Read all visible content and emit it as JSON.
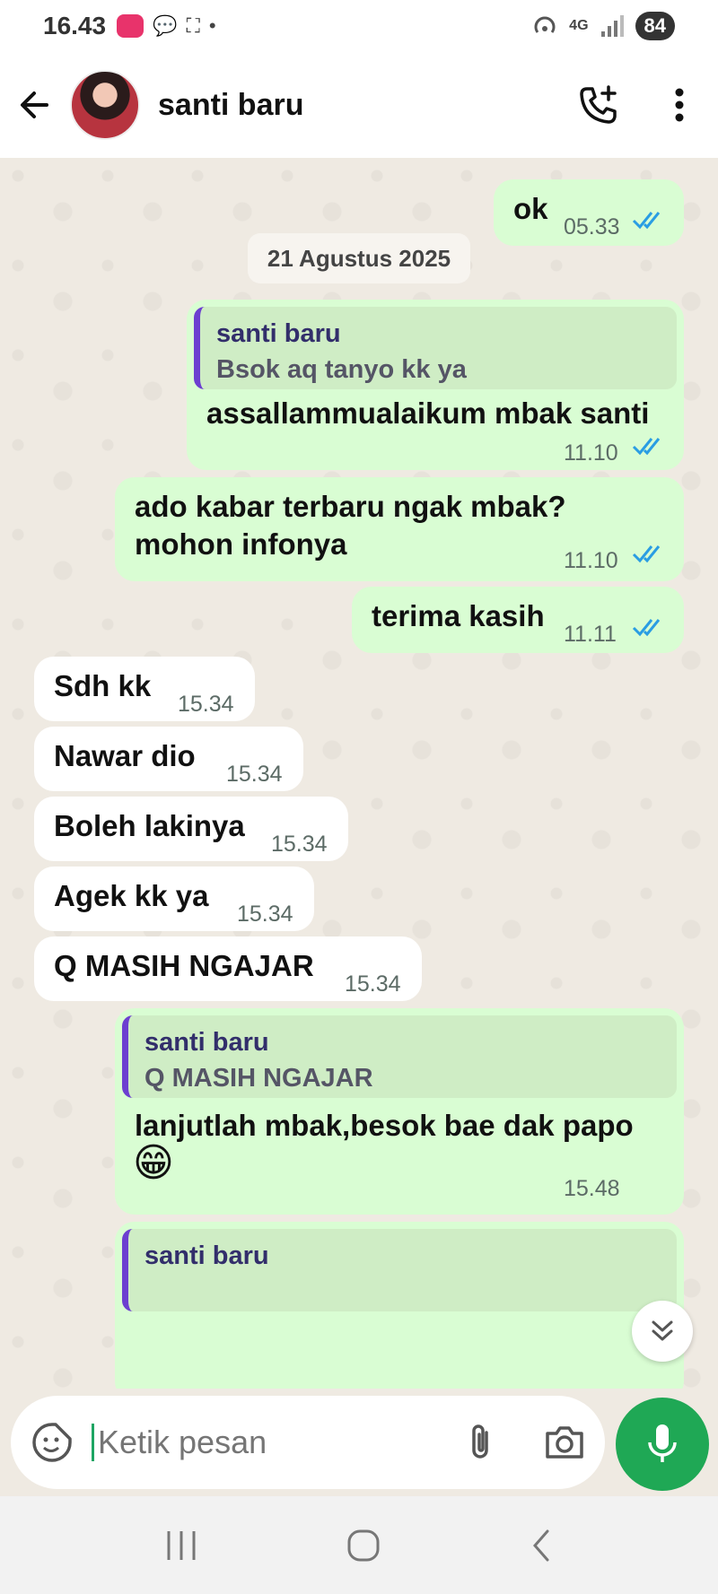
{
  "status_bar": {
    "time": "16.43",
    "network": "4G",
    "battery": "84"
  },
  "header": {
    "contact_name": "santi baru"
  },
  "messages": {
    "m1": {
      "text": "ok",
      "time": "05.33"
    },
    "date_chip": "21 Agustus 2025",
    "m2": {
      "quote_name": "santi baru",
      "quote_text": "Bsok aq tanyo kk ya",
      "text": "assallammualaikum mbak santi",
      "time": "11.10"
    },
    "m3": {
      "line1": "ado kabar terbaru ngak mbak?",
      "line2": "mohon infonya",
      "time": "11.10"
    },
    "m4": {
      "text": "terima kasih",
      "time": "11.11"
    },
    "m5": {
      "text": "Sdh kk",
      "time": "15.34"
    },
    "m6": {
      "text": "Nawar dio",
      "time": "15.34"
    },
    "m7": {
      "text": "Boleh lakinya",
      "time": "15.34"
    },
    "m8": {
      "text": "Agek kk ya",
      "time": "15.34"
    },
    "m9": {
      "text": "Q MASIH NGAJAR",
      "time": "15.34"
    },
    "m10": {
      "quote_name": "santi baru",
      "quote_text": "Q MASIH NGAJAR",
      "text": "lanjutlah mbak,besok bae dak papo",
      "emoji": "😁",
      "time": "15.48"
    },
    "m11": {
      "quote_name": "santi baru"
    }
  },
  "composer": {
    "placeholder": "Ketik pesan"
  },
  "colors": {
    "outgoing": "#d9fdd3",
    "incoming": "#ffffff",
    "accent": "#1fa855",
    "ticks": "#2a9de3"
  }
}
